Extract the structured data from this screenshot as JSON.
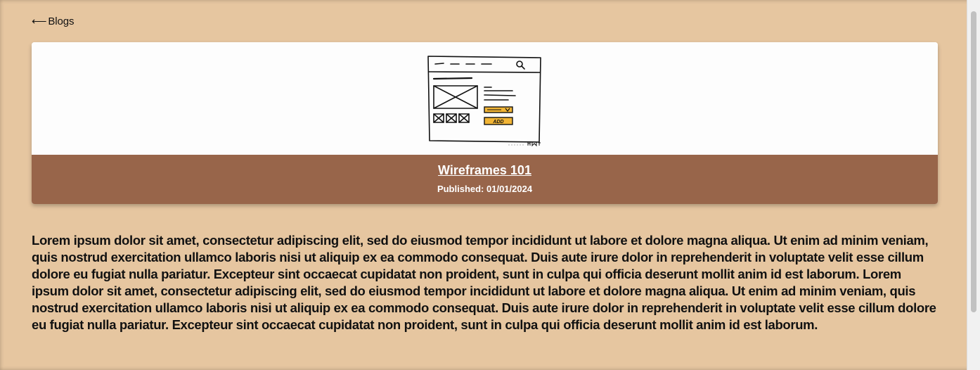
{
  "nav": {
    "back_arrow": "⟵",
    "back_label": "Blogs"
  },
  "post": {
    "title": "Wireframes 101",
    "published": "Published: 01/01/2024",
    "image_wireframe_button_text": "ADD",
    "body": "Lorem ipsum dolor sit amet, consectetur adipiscing elit, sed do eiusmod tempor incididunt ut labore et dolore magna aliqua. Ut enim ad minim veniam, quis nostrud exercitation ullamco laboris nisi ut aliquip ex ea commodo consequat. Duis aute irure dolor in reprehenderit in voluptate velit esse cillum dolore eu fugiat nulla pariatur. Excepteur sint occaecat cupidatat non proident, sunt in culpa qui officia deserunt mollit anim id est laborum. Lorem ipsum dolor sit amet, consectetur adipiscing elit, sed do eiusmod tempor incididunt ut labore et dolore magna aliqua. Ut enim ad minim veniam, quis nostrud exercitation ullamco laboris nisi ut aliquip ex ea commodo consequat. Duis aute irure dolor in reprehenderit in voluptate velit esse cillum dolore eu fugiat nulla pariatur. Excepteur sint occaecat cupidatat non proident, sunt in culpa qui officia deserunt mollit anim id est laborum."
  },
  "colors": {
    "page_background": "#e6c6a0",
    "card_footer": "#98654a",
    "wireframe_accent": "#f2b535"
  },
  "icons": {
    "back": "left-arrow-icon",
    "wireframe_search": "search-icon"
  }
}
